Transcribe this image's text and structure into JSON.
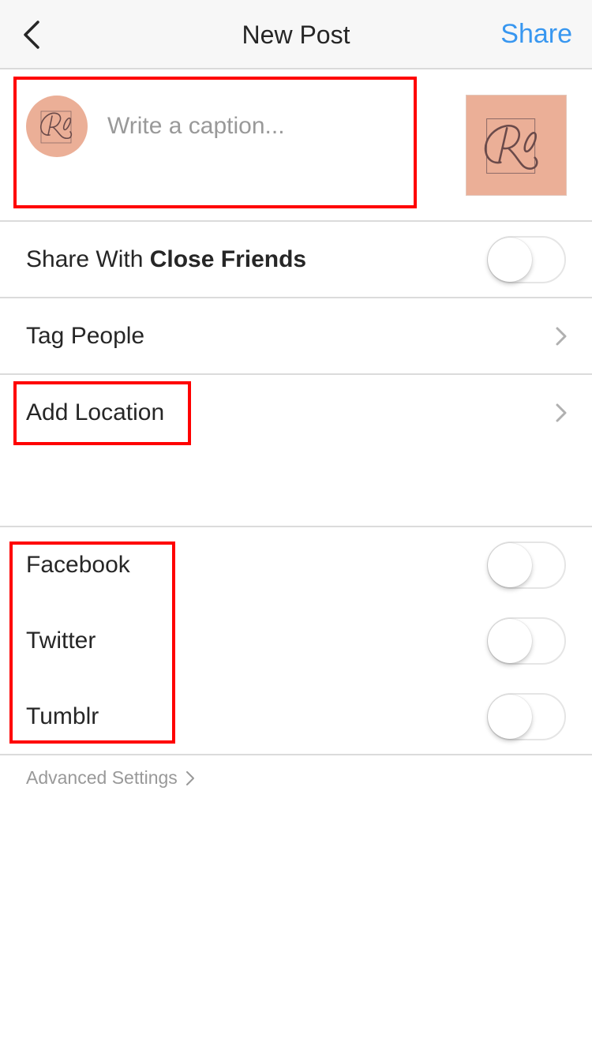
{
  "header": {
    "back_icon": "chevron-left-icon",
    "title": "New Post",
    "share_label": "Share",
    "share_color": "#3897f0"
  },
  "caption": {
    "placeholder": "Write a caption...",
    "value": "",
    "avatar_initials": "Ro",
    "avatar_color": "#ebaf97",
    "thumbnail_initials": "Ro",
    "thumbnail_color": "#ebaf97"
  },
  "rows": {
    "close_friends": {
      "label_prefix": "Share With ",
      "label_bold": "Close Friends",
      "toggle_on": false
    },
    "tag_people": {
      "label": "Tag People",
      "icon": "chevron-right-icon"
    },
    "add_location": {
      "label": "Add Location",
      "icon": "chevron-right-icon"
    }
  },
  "share_to": [
    {
      "label": "Facebook",
      "toggle_on": false
    },
    {
      "label": "Twitter",
      "toggle_on": false
    },
    {
      "label": "Tumblr",
      "toggle_on": false
    }
  ],
  "advanced": {
    "label": "Advanced Settings",
    "icon": "chevron-right-icon"
  },
  "annotations": {
    "highlight_color": "#ff0000",
    "highlighted": [
      "caption-input",
      "add-location-row",
      "share-to-list"
    ]
  }
}
